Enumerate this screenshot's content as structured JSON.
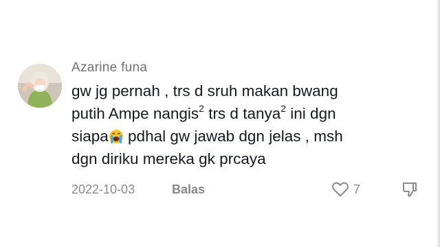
{
  "comment": {
    "author": "Azarine funa",
    "lines": [
      {
        "a": "gw jg pernah , trs d sruh makan bwang"
      },
      {
        "a": "putih Ampe nangis",
        "sup1": "2",
        "b": " trs d tanya",
        "sup2": "2",
        "c": " ini dgn"
      },
      {
        "a": "siapa",
        "emoji": "loudly-crying-face",
        "b": " pdhal gw jawab dgn jelas , msh"
      },
      {
        "a": "dgn diriku mereka gk prcaya"
      }
    ],
    "date": "2022-10-03",
    "reply_label": "Balas",
    "like_count": "7"
  },
  "icons": {
    "like": "heart-outline-icon",
    "dislike": "thumbs-down-icon"
  },
  "colors": {
    "text": "#161823",
    "muted": "#8a8a8a"
  }
}
